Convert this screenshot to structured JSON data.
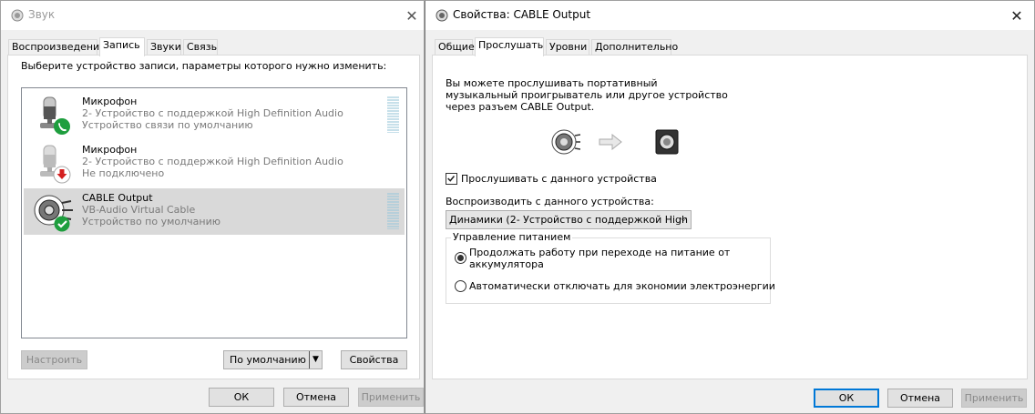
{
  "sound_window": {
    "title": "Звук",
    "tabs": [
      "Воспроизведение",
      "Запись",
      "Звуки",
      "Связь"
    ],
    "active_tab": "Запись",
    "instruction": "Выберите устройство записи, параметры которого нужно изменить:",
    "devices": [
      {
        "name": "Микрофон",
        "line1": "2- Устройство с поддержкой High Definition Audio",
        "line2": "Устройство связи по умолчанию",
        "status_icon": "phone-icon",
        "selected": false
      },
      {
        "name": "Микрофон",
        "line1": "2- Устройство с поддержкой High Definition Audio",
        "line2": "Не подключено",
        "status_icon": "down-arrow-icon",
        "selected": false
      },
      {
        "name": "CABLE Output",
        "line1": "VB-Audio Virtual Cable",
        "line2": "Устройство по умолчанию",
        "status_icon": "check-icon",
        "selected": true
      }
    ],
    "buttons": {
      "configure": "Настроить",
      "set_default": "По умолчанию",
      "properties": "Свойства",
      "ok": "ОК",
      "cancel": "Отмена",
      "apply": "Применить"
    }
  },
  "props_window": {
    "title": "Свойства: CABLE Output",
    "tabs": [
      "Общие",
      "Прослушать",
      "Уровни",
      "Дополнительно"
    ],
    "active_tab": "Прослушать",
    "description": "Вы можете прослушивать портативный музыкальный проигрыватель или другое устройство через разъем CABLE Output.",
    "listen_checkbox": {
      "label": "Прослушивать с данного устройства",
      "checked": true
    },
    "playback_label": "Воспроизводить с данного устройства:",
    "playback_value": "Динамики (2- Устройство с поддержкой High",
    "power_group": {
      "title": "Управление питанием",
      "option_continue": "Продолжать работу при переходе на питание от аккумулятора",
      "option_auto_off": "Автоматически отключать для экономии электроэнергии",
      "selected": "continue"
    },
    "buttons": {
      "ok": "ОК",
      "cancel": "Отмена",
      "apply": "Применить"
    }
  },
  "colors": {
    "selection": "#d9d9d9",
    "accent": "#0078d7",
    "status_green": "#1e9e3e",
    "status_red": "#d41f1f"
  }
}
